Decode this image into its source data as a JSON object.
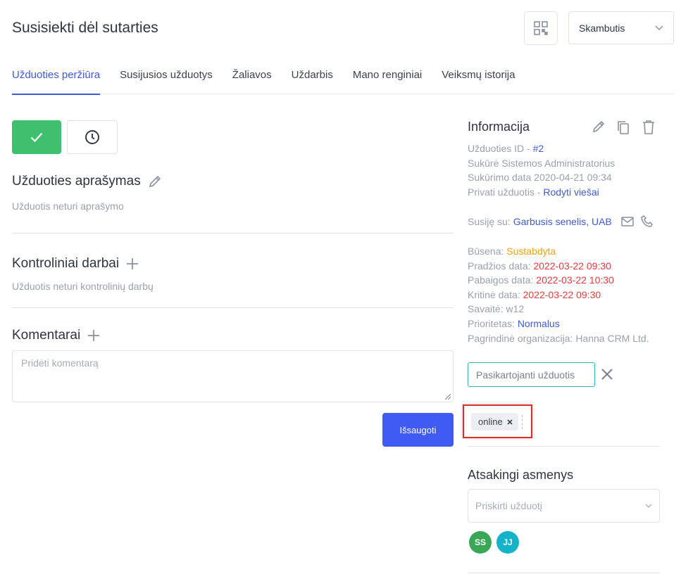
{
  "header": {
    "title": "Susisiekti dėl sutarties",
    "type_select": "Skambutis"
  },
  "tabs": [
    {
      "label": "Užduoties peržiūra",
      "active": true
    },
    {
      "label": "Susijusios užduotys",
      "active": false
    },
    {
      "label": "Žaliavos",
      "active": false
    },
    {
      "label": "Uždarbis",
      "active": false
    },
    {
      "label": "Mano renginiai",
      "active": false
    },
    {
      "label": "Veiksmų istorija",
      "active": false
    }
  ],
  "description": {
    "title": "Užduoties aprašymas",
    "empty_text": "Užduotis neturi aprašymo"
  },
  "control_works": {
    "title": "Kontroliniai darbai",
    "empty_text": "Užduotis neturi kontrolinių darbų"
  },
  "comments": {
    "title": "Komentarai",
    "placeholder": "Pridėti komentarą",
    "save_label": "Išsaugoti"
  },
  "info": {
    "title": "Informacija",
    "task_id_label": "Užduoties ID - ",
    "task_id_value": "#2",
    "created_by": "Sukūrė Sistemos Administratorius",
    "created_date": "Sukūrimo data 2020-04-21 09:34",
    "private_label": "Privati užduotis - ",
    "private_link": "Rodyti viešai",
    "related_label": "Susiję su: ",
    "related_value": "Garbusis senelis, UAB",
    "status_label": "Būsena: ",
    "status_value": "Sustabdyta",
    "start_label": "Pradžios data: ",
    "start_value": "2022-03-22 09:30",
    "end_label": "Pabaigos data: ",
    "end_value": "2022-03-22 10:30",
    "critical_label": "Kritinė data: ",
    "critical_value": "2022-03-22 09:30",
    "week": "Savaitė: w12",
    "priority_label": "Prioritetas: ",
    "priority_value": "Normalus",
    "org": "Pagrindinė organizacija: Hanna CRM Ltd.",
    "recurring_label": "Pasikartojanti užduotis",
    "tag": "online"
  },
  "responsible": {
    "title": "Atsakingi asmenys",
    "placeholder": "Priskirti užduotį",
    "avatars": [
      {
        "initials": "SS",
        "color": "#3aa757"
      },
      {
        "initials": "JJ",
        "color": "#14b3c9"
      }
    ]
  },
  "colors": {
    "accent": "#3f5bd8",
    "success": "#3ec06f",
    "status_orange": "#f2a10c",
    "date_red": "#e43c3c"
  }
}
